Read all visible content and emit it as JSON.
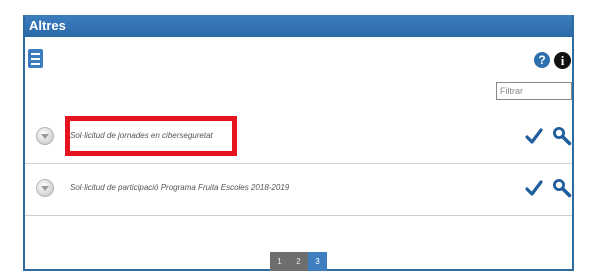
{
  "panel": {
    "title": "Altres"
  },
  "toolbar": {
    "help_label": "?",
    "info_label": "i"
  },
  "filter": {
    "placeholder": "Filtrar",
    "value": ""
  },
  "rows": [
    {
      "label": "Sol·licitud de jornades en ciberseguretat",
      "highlighted": true
    },
    {
      "label": "Sol·licitud de participació Programa Fruita Escoles 2018-2019",
      "highlighted": false
    }
  ],
  "pagination": {
    "pages": [
      "1",
      "2",
      "3"
    ],
    "current": "3"
  },
  "colors": {
    "header": "#2f6aa0",
    "accent": "#3b7cc0",
    "highlight": "#e5141e",
    "icon": "#1f5f9e"
  },
  "icons": {
    "menu": "hamburger-icon",
    "help": "help-icon",
    "info": "info-icon",
    "expand": "expand-circle-icon",
    "check": "checkmark-icon",
    "search": "magnifier-icon"
  }
}
